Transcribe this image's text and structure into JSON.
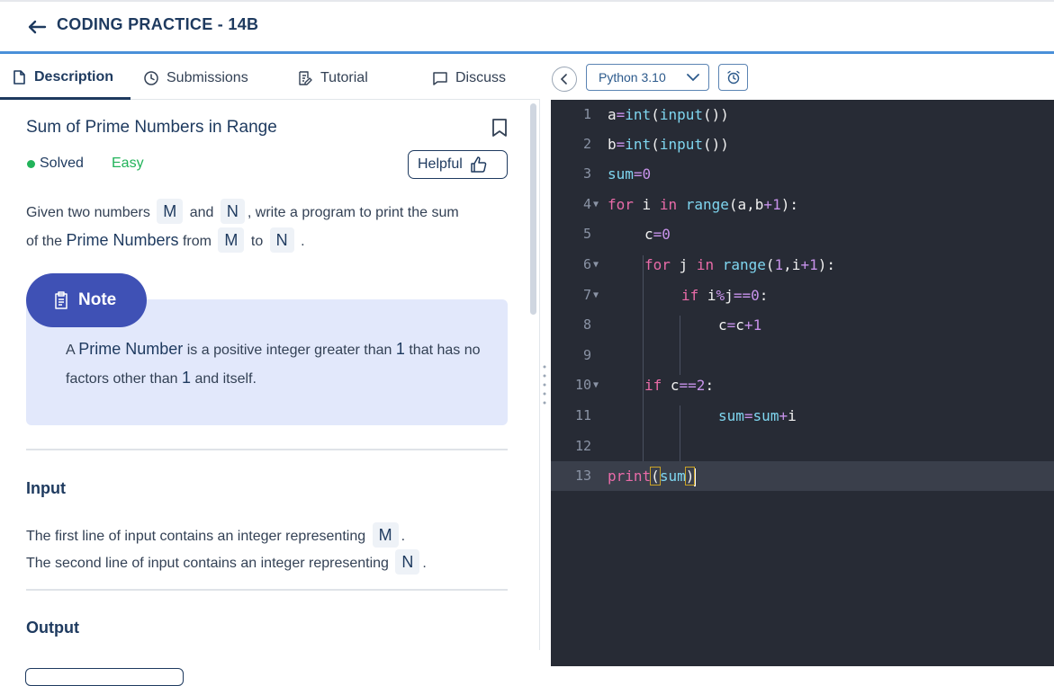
{
  "header": {
    "title": "CODING PRACTICE - 14B"
  },
  "tabs": [
    {
      "label": "Description",
      "icon": "document-icon"
    },
    {
      "label": "Submissions",
      "icon": "clock-icon"
    },
    {
      "label": "Tutorial",
      "icon": "notes-icon"
    },
    {
      "label": "Discuss",
      "icon": "chat-icon"
    }
  ],
  "problem": {
    "title": "Sum of Prime Numbers in Range",
    "status": "Solved",
    "difficulty": "Easy",
    "helpful_label": "Helpful",
    "desc": {
      "t1": "Given two numbers",
      "m": "M",
      "t2": "and",
      "n": "N",
      "t3": ", write a program to print the sum",
      "t4": "of the",
      "prime": "Prime Numbers",
      "t5": "from",
      "t6": "to",
      "t7": "."
    },
    "note": {
      "label": "Note",
      "a": "A",
      "prime": "Prime Number",
      "t1": "is a positive integer greater than",
      "one": "1",
      "t2": "that has no factors other than",
      "t3": "and itself."
    },
    "input_heading": "Input",
    "input_line1": "The first line of input contains an integer representing",
    "input_line2": "The second line of input contains an integer representing",
    "output_heading": "Output"
  },
  "editor": {
    "language": "Python 3.10",
    "line_numbers": [
      "1",
      "2",
      "3",
      "4",
      "5",
      "6",
      "7",
      "8",
      "9",
      "10",
      "11",
      "12",
      "13"
    ],
    "code": {
      "l1": [
        "a",
        "=",
        "int",
        "(",
        "input",
        "())"
      ],
      "l2": [
        "b",
        "=",
        "int",
        "(",
        "input",
        "())"
      ],
      "l3": [
        "sum",
        "=",
        "0"
      ],
      "l4": [
        "for",
        " i ",
        "in",
        " ",
        "range",
        "(a,b",
        "+",
        "1",
        "):"
      ],
      "l5": [
        "c",
        "=",
        "0"
      ],
      "l6": [
        "for",
        " j ",
        "in",
        " ",
        "range",
        "(",
        "1",
        ",i",
        "+",
        "1",
        "):"
      ],
      "l7": [
        "if",
        " i",
        "%",
        "j",
        "==",
        "0",
        ":"
      ],
      "l8": [
        "c",
        "=",
        "c",
        "+",
        "1"
      ],
      "l10": [
        "if",
        " c",
        "==",
        "2",
        ":"
      ],
      "l11": [
        "sum",
        "=",
        "sum",
        "+",
        "i"
      ],
      "l13": [
        "print",
        "(",
        "sum",
        ")"
      ]
    }
  },
  "colors": {
    "brand": "#1e3a5f",
    "accent": "#4a90d9",
    "success": "#22b35a",
    "note_badge": "#3f51b5",
    "editor_bg": "#272b35"
  }
}
